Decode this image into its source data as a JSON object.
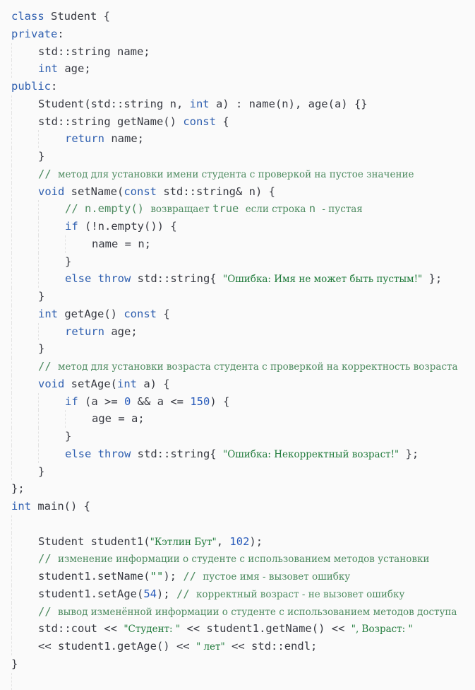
{
  "code": {
    "lines": [
      {
        "indent": 0,
        "guides": 0,
        "tokens": [
          {
            "t": "kw",
            "v": "class"
          },
          {
            "t": "p",
            "v": " Student {"
          }
        ]
      },
      {
        "indent": 0,
        "guides": 0,
        "tokens": [
          {
            "t": "kw",
            "v": "private"
          },
          {
            "t": "p",
            "v": ":"
          }
        ]
      },
      {
        "indent": 1,
        "guides": 1,
        "tokens": [
          {
            "t": "p",
            "v": "std::string name;"
          }
        ]
      },
      {
        "indent": 1,
        "guides": 1,
        "tokens": [
          {
            "t": "kw",
            "v": "int"
          },
          {
            "t": "p",
            "v": " age;"
          }
        ]
      },
      {
        "indent": 0,
        "guides": 0,
        "tokens": [
          {
            "t": "kw",
            "v": "public"
          },
          {
            "t": "p",
            "v": ":"
          }
        ]
      },
      {
        "indent": 1,
        "guides": 1,
        "tokens": [
          {
            "t": "p",
            "v": "Student(std::string n, "
          },
          {
            "t": "kw",
            "v": "int"
          },
          {
            "t": "p",
            "v": " a) : name(n), age(a) {}"
          }
        ]
      },
      {
        "indent": 1,
        "guides": 1,
        "tokens": [
          {
            "t": "p",
            "v": "std::string getName() "
          },
          {
            "t": "kw",
            "v": "const"
          },
          {
            "t": "p",
            "v": " {"
          }
        ]
      },
      {
        "indent": 2,
        "guides": 2,
        "tokens": [
          {
            "t": "kw",
            "v": "return"
          },
          {
            "t": "p",
            "v": " name;"
          }
        ]
      },
      {
        "indent": 1,
        "guides": 1,
        "tokens": [
          {
            "t": "p",
            "v": "}"
          }
        ]
      },
      {
        "indent": 1,
        "guides": 1,
        "tokens": [
          {
            "t": "cm",
            "v": "// "
          },
          {
            "t": "cmru",
            "v": "метод для установки имени студента с проверкой на пустое значение"
          }
        ]
      },
      {
        "indent": 1,
        "guides": 1,
        "tokens": [
          {
            "t": "kw",
            "v": "void"
          },
          {
            "t": "p",
            "v": " setName("
          },
          {
            "t": "kw",
            "v": "const"
          },
          {
            "t": "p",
            "v": " std::string& n) {"
          }
        ]
      },
      {
        "indent": 2,
        "guides": 2,
        "tokens": [
          {
            "t": "cm",
            "v": "// n.empty() "
          },
          {
            "t": "cmru",
            "v": "возвращает "
          },
          {
            "t": "cm",
            "v": "true "
          },
          {
            "t": "cmru",
            "v": "если строка "
          },
          {
            "t": "cm",
            "v": "n "
          },
          {
            "t": "cmru",
            "v": "- пустая"
          }
        ]
      },
      {
        "indent": 2,
        "guides": 2,
        "tokens": [
          {
            "t": "kw",
            "v": "if"
          },
          {
            "t": "p",
            "v": " (!n.empty()) {"
          }
        ]
      },
      {
        "indent": 3,
        "guides": 3,
        "tokens": [
          {
            "t": "p",
            "v": "name = n;"
          }
        ]
      },
      {
        "indent": 2,
        "guides": 2,
        "tokens": [
          {
            "t": "p",
            "v": "}"
          }
        ]
      },
      {
        "indent": 2,
        "guides": 2,
        "tokens": [
          {
            "t": "kw",
            "v": "else throw"
          },
          {
            "t": "p",
            "v": " std::string{ "
          },
          {
            "t": "strru",
            "v": "\"Ошибка: Имя не может быть пустым!\""
          },
          {
            "t": "p",
            "v": " };"
          }
        ]
      },
      {
        "indent": 1,
        "guides": 1,
        "tokens": [
          {
            "t": "p",
            "v": "}"
          }
        ]
      },
      {
        "indent": 1,
        "guides": 1,
        "tokens": [
          {
            "t": "kw",
            "v": "int"
          },
          {
            "t": "p",
            "v": " getAge() "
          },
          {
            "t": "kw",
            "v": "const"
          },
          {
            "t": "p",
            "v": " {"
          }
        ]
      },
      {
        "indent": 2,
        "guides": 2,
        "tokens": [
          {
            "t": "kw",
            "v": "return"
          },
          {
            "t": "p",
            "v": " age;"
          }
        ]
      },
      {
        "indent": 1,
        "guides": 1,
        "tokens": [
          {
            "t": "p",
            "v": "}"
          }
        ]
      },
      {
        "indent": 1,
        "guides": 1,
        "tokens": [
          {
            "t": "cm",
            "v": "// "
          },
          {
            "t": "cmru",
            "v": "метод для установки возраста студента с проверкой на корректность возраста"
          }
        ]
      },
      {
        "indent": 1,
        "guides": 1,
        "tokens": [
          {
            "t": "kw",
            "v": "void"
          },
          {
            "t": "p",
            "v": " setAge("
          },
          {
            "t": "kw",
            "v": "int"
          },
          {
            "t": "p",
            "v": " a) {"
          }
        ]
      },
      {
        "indent": 2,
        "guides": 2,
        "tokens": [
          {
            "t": "kw",
            "v": "if"
          },
          {
            "t": "p",
            "v": " (a >= "
          },
          {
            "t": "num",
            "v": "0"
          },
          {
            "t": "p",
            "v": " && a <= "
          },
          {
            "t": "num",
            "v": "150"
          },
          {
            "t": "p",
            "v": ") {"
          }
        ]
      },
      {
        "indent": 3,
        "guides": 3,
        "tokens": [
          {
            "t": "p",
            "v": "age = a;"
          }
        ]
      },
      {
        "indent": 2,
        "guides": 2,
        "tokens": [
          {
            "t": "p",
            "v": "}"
          }
        ]
      },
      {
        "indent": 2,
        "guides": 2,
        "tokens": [
          {
            "t": "kw",
            "v": "else throw"
          },
          {
            "t": "p",
            "v": " std::string{ "
          },
          {
            "t": "strru",
            "v": "\"Ошибка: Некорректный возраст!\""
          },
          {
            "t": "p",
            "v": " };"
          }
        ]
      },
      {
        "indent": 1,
        "guides": 1,
        "tokens": [
          {
            "t": "p",
            "v": "}"
          }
        ]
      },
      {
        "indent": 0,
        "guides": 0,
        "tokens": [
          {
            "t": "p",
            "v": "};"
          }
        ]
      },
      {
        "indent": 0,
        "guides": 0,
        "tokens": [
          {
            "t": "kw",
            "v": "int"
          },
          {
            "t": "p",
            "v": " main() {"
          }
        ]
      },
      {
        "indent": 0,
        "guides": 1,
        "tokens": []
      },
      {
        "indent": 1,
        "guides": 1,
        "tokens": [
          {
            "t": "p",
            "v": "Student student1("
          },
          {
            "t": "strru",
            "v": "\"Кэтлин Бут\""
          },
          {
            "t": "p",
            "v": ", "
          },
          {
            "t": "num",
            "v": "102"
          },
          {
            "t": "p",
            "v": ");"
          }
        ]
      },
      {
        "indent": 1,
        "guides": 1,
        "tokens": [
          {
            "t": "cm",
            "v": "// "
          },
          {
            "t": "cmru",
            "v": "изменение информации о студенте с использованием методов установки"
          }
        ]
      },
      {
        "indent": 1,
        "guides": 1,
        "tokens": [
          {
            "t": "p",
            "v": "student1.setName("
          },
          {
            "t": "str",
            "v": "\"\""
          },
          {
            "t": "p",
            "v": "); "
          },
          {
            "t": "cm",
            "v": "// "
          },
          {
            "t": "cmru",
            "v": "пустое имя - вызовет ошибку"
          }
        ]
      },
      {
        "indent": 1,
        "guides": 1,
        "tokens": [
          {
            "t": "p",
            "v": "student1.setAge("
          },
          {
            "t": "num",
            "v": "54"
          },
          {
            "t": "p",
            "v": "); "
          },
          {
            "t": "cm",
            "v": "// "
          },
          {
            "t": "cmru",
            "v": "корректный возраст - не вызовет ошибку"
          }
        ]
      },
      {
        "indent": 1,
        "guides": 1,
        "tokens": [
          {
            "t": "cm",
            "v": "// "
          },
          {
            "t": "cmru",
            "v": "вывод изменённой информации о студенте с использованием методов доступа"
          }
        ]
      },
      {
        "indent": 1,
        "guides": 1,
        "tokens": [
          {
            "t": "p",
            "v": "std::cout << "
          },
          {
            "t": "strru",
            "v": "\"Студент: \""
          },
          {
            "t": "p",
            "v": " << student1.getName() << "
          },
          {
            "t": "strru",
            "v": "\", Возраст: \""
          }
        ]
      },
      {
        "indent": 1,
        "guides": 1,
        "tokens": [
          {
            "t": "p",
            "v": "<< student1.getAge() << "
          },
          {
            "t": "strru",
            "v": "\" лет\""
          },
          {
            "t": "p",
            "v": " << std::endl;"
          }
        ]
      },
      {
        "indent": 0,
        "guides": 0,
        "tokens": [
          {
            "t": "p",
            "v": "}"
          }
        ]
      },
      {
        "indent": 0,
        "guides": 1,
        "tokens": []
      }
    ]
  }
}
